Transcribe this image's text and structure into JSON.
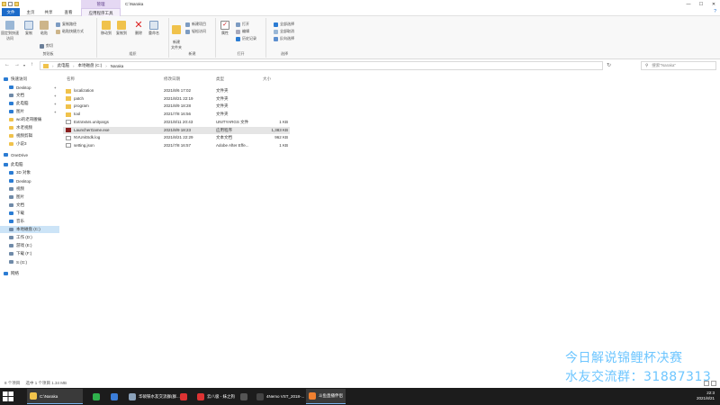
{
  "window": {
    "title": "C:\\Naraka",
    "context_tab_group": "管理"
  },
  "ribbon_tabs": [
    {
      "label": "文件"
    },
    {
      "label": "主页"
    },
    {
      "label": "共享"
    },
    {
      "label": "查看"
    },
    {
      "label": "应用程序工具"
    }
  ],
  "ribbon": {
    "clipboard": {
      "label": "剪贴板",
      "pin": "固定到快速访问",
      "copy": "复制",
      "paste": "粘贴",
      "copy_path": "复制路径",
      "paste_shortcut": "粘贴快捷方式",
      "cut": "剪切"
    },
    "organize": {
      "label": "组织",
      "move_to": "移动到",
      "copy_to": "复制到",
      "delete": "删除",
      "rename": "重命名"
    },
    "new": {
      "label": "新建",
      "new_folder": "新建\n文件夹",
      "new_item": "新建项目",
      "easy_access": "轻松访问"
    },
    "open": {
      "label": "打开",
      "properties": "属性",
      "open": "打开",
      "edit": "编辑",
      "history": "历史记录"
    },
    "select": {
      "label": "选择",
      "select_all": "全部选择",
      "select_none": "全部取消",
      "invert": "反向选择"
    }
  },
  "address": {
    "crumbs": [
      "此电脑",
      "本地磁盘 (C:)",
      "Naraka"
    ],
    "search_placeholder": "搜索\"Naraka\""
  },
  "sidebar": {
    "items": [
      {
        "label": "快速访问",
        "icon": "star-icon",
        "color": "#2b7cd3",
        "pin": false,
        "level": 0
      },
      {
        "label": "Desktop",
        "icon": "desktop-icon",
        "color": "#2b7cd3",
        "pin": true,
        "level": 1
      },
      {
        "label": "文档",
        "icon": "document-icon",
        "color": "#6f8aa8",
        "pin": true,
        "level": 1
      },
      {
        "label": "此电脑",
        "icon": "computer-icon",
        "color": "#2b7cd3",
        "pin": true,
        "level": 1
      },
      {
        "label": "图片",
        "icon": "pictures-icon",
        "color": "#2b7cd3",
        "pin": true,
        "level": 1
      },
      {
        "label": "wo的老哥腰痛",
        "icon": "folder-icon",
        "color": "#f0c24b",
        "pin": false,
        "level": 1
      },
      {
        "label": "水老视频",
        "icon": "folder-icon",
        "color": "#f0c24b",
        "pin": false,
        "level": 1
      },
      {
        "label": "视频剪辑",
        "icon": "folder-icon",
        "color": "#f0c24b",
        "pin": false,
        "level": 1
      },
      {
        "label": "小说3",
        "icon": "folder-icon",
        "color": "#f0c24b",
        "pin": false,
        "level": 1
      },
      {
        "label": "OneDrive",
        "icon": "cloud-icon",
        "color": "#2b7cd3",
        "pin": false,
        "level": 0
      },
      {
        "label": "此电脑",
        "icon": "computer-icon",
        "color": "#2b7cd3",
        "pin": false,
        "level": 0
      },
      {
        "label": "3D 对象",
        "icon": "cube-icon",
        "color": "#2b7cd3",
        "pin": false,
        "level": 1
      },
      {
        "label": "Desktop",
        "icon": "desktop-icon",
        "color": "#2b7cd3",
        "pin": false,
        "level": 1
      },
      {
        "label": "视频",
        "icon": "video-icon",
        "color": "#6f8aa8",
        "pin": false,
        "level": 1
      },
      {
        "label": "图片",
        "icon": "pictures-icon",
        "color": "#6f8aa8",
        "pin": false,
        "level": 1
      },
      {
        "label": "文档",
        "icon": "document-icon",
        "color": "#6f8aa8",
        "pin": false,
        "level": 1
      },
      {
        "label": "下载",
        "icon": "download-icon",
        "color": "#2b7cd3",
        "pin": false,
        "level": 1
      },
      {
        "label": "音乐",
        "icon": "music-icon",
        "color": "#2b7cd3",
        "pin": false,
        "level": 1
      },
      {
        "label": "本地磁盘 (C:)",
        "icon": "drive-icon",
        "color": "#6f8aa8",
        "pin": false,
        "level": 1,
        "selected": true
      },
      {
        "label": "工作 (D:)",
        "icon": "drive-icon",
        "color": "#6f8aa8",
        "pin": false,
        "level": 1
      },
      {
        "label": "游戏 (E:)",
        "icon": "drive-icon",
        "color": "#6f8aa8",
        "pin": false,
        "level": 1
      },
      {
        "label": "下载 (F:)",
        "icon": "drive-icon",
        "color": "#6f8aa8",
        "pin": false,
        "level": 1
      },
      {
        "label": "S (G:)",
        "icon": "drive-icon",
        "color": "#6f8aa8",
        "pin": false,
        "level": 1
      },
      {
        "label": "网络",
        "icon": "network-icon",
        "color": "#2b7cd3",
        "pin": false,
        "level": 0
      }
    ]
  },
  "file_list": {
    "columns": [
      "名称",
      "修改日期",
      "类型",
      "大小"
    ],
    "rows": [
      {
        "name": "localization",
        "date": "2021/8/6 17:02",
        "type": "文件夹",
        "size": "",
        "icon": "folder-icon",
        "color": "#f0c24b"
      },
      {
        "name": "patch",
        "date": "2021/8/21 22:19",
        "type": "文件夹",
        "size": "",
        "icon": "folder-icon",
        "color": "#f0c24b"
      },
      {
        "name": "program",
        "date": "2021/8/9 18:28",
        "type": "文件夹",
        "size": "",
        "icon": "folder-icon",
        "color": "#f0c24b"
      },
      {
        "name": "tool",
        "date": "2021/7/8 16:56",
        "type": "文件夹",
        "size": "",
        "icon": "folder-icon",
        "color": "#f0c24b"
      },
      {
        "name": "ExtraVars.unityargs",
        "date": "2021/8/11 20:43",
        "type": "UNITYARGS 文件",
        "size": "1 KB",
        "icon": "file-icon",
        "color": "#ffffff"
      },
      {
        "name": "LauncherGame.exe",
        "date": "2021/8/9 18:23",
        "type": "应用程序",
        "size": "1,383 KB",
        "icon": "exe-icon",
        "color": "#8a1f1f",
        "selected": true
      },
      {
        "name": "NVUnitSdk.log",
        "date": "2021/8/21 22:29",
        "type": "文本文档",
        "size": "962 KB",
        "icon": "log-icon",
        "color": "#ffffff"
      },
      {
        "name": "setting.json",
        "date": "2021/7/8 16:57",
        "type": "Adobe After Effe...",
        "size": "1 KB",
        "icon": "json-icon",
        "color": "#ffffff"
      }
    ]
  },
  "status": {
    "count": "8 个项目",
    "selected": "选中 1 个项目  1.34 MB"
  },
  "overlay": {
    "line1": "今日解说锦鲤杯决赛",
    "line2": "水友交流群：31887313"
  },
  "taskbar": {
    "items": [
      {
        "label": "C:\\Naraka",
        "icon": "explorer-icon",
        "color": "#f0c24b",
        "active": true
      },
      {
        "label": "",
        "icon": "app-green-icon",
        "color": "#2fb24c",
        "active": false
      },
      {
        "label": "",
        "icon": "app-blue-icon",
        "color": "#3b7dd8",
        "active": false
      },
      {
        "label": "华硕铁水友交流群(群...",
        "icon": "chat-icon",
        "color": "#8aa1b9",
        "active": false
      },
      {
        "label": "",
        "icon": "app-red-icon",
        "color": "#d33",
        "active": false
      },
      {
        "label": "云八极 - 妹之狗",
        "icon": "netease-icon",
        "color": "#d33",
        "active": false
      },
      {
        "label": "",
        "icon": "app-dark-icon",
        "color": "#555",
        "active": false
      },
      {
        "label": "4Nemo VST_2018-...",
        "icon": "audio-icon",
        "color": "#444",
        "active": false
      },
      {
        "label": "斗鱼直播伴侣",
        "icon": "douyu-icon",
        "color": "#f08030",
        "active": true
      }
    ],
    "clock_time": "22:3",
    "clock_date": "2021/8/21"
  }
}
